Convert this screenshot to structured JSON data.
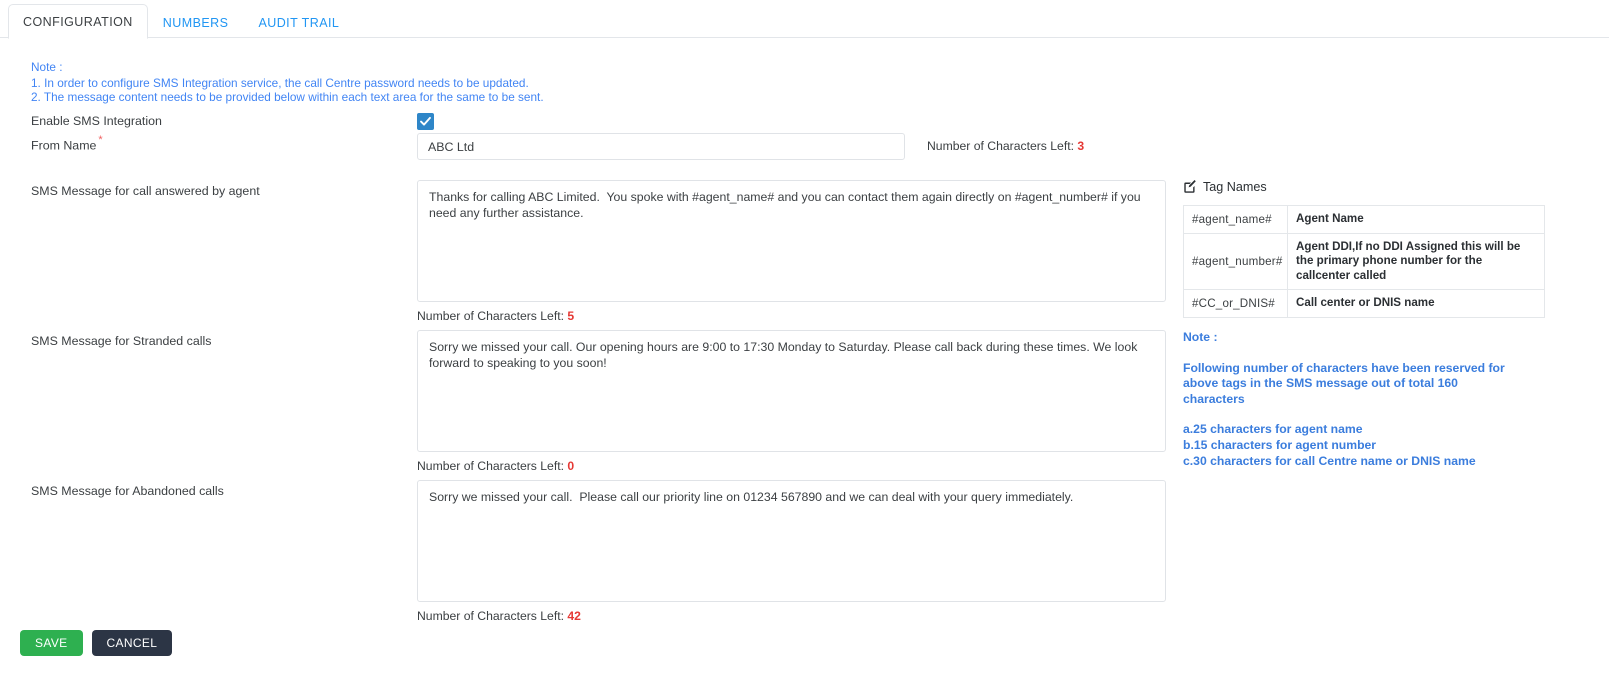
{
  "tabs": [
    {
      "label": "CONFIGURATION",
      "active": true
    },
    {
      "label": "NUMBERS",
      "active": false
    },
    {
      "label": "AUDIT TRAIL",
      "active": false
    }
  ],
  "top_note": {
    "heading": "Note :",
    "line1": "1. In order to configure SMS Integration service, the call Centre password needs to be updated.",
    "line2": "2. The message content needs to be provided below within each text area for the same to be sent."
  },
  "form": {
    "enable_label": "Enable SMS Integration",
    "enable_checked": true,
    "checkbox_color": "#2e86c8",
    "from_label": "From Name",
    "from_required_marker": "*",
    "from_value": "ABC Ltd",
    "from_placeholder": "",
    "from_count_label": "Number of Characters Left:",
    "from_count_value": "3"
  },
  "messages": [
    {
      "label": "SMS Message for call answered by agent",
      "value": "Thanks for calling ABC Limited.  You spoke with #agent_name# and you can contact them again directly on #agent_number# if you need any further assistance.",
      "placeholder": "",
      "count_label": "Number of Characters Left:",
      "count_value": "5"
    },
    {
      "label": "SMS Message for Stranded calls",
      "value": "Sorry we missed your call. Our opening hours are 9:00 to 17:30 Monday to Saturday. Please call back during these times. We look forward to speaking to you soon!",
      "placeholder": "",
      "count_label": "Number of Characters Left:",
      "count_value": "0"
    },
    {
      "label": "SMS Message for Abandoned calls",
      "value": "Sorry we missed your call.  Please call our priority line on 01234 567890 and we can deal with your query immediately.",
      "placeholder": "",
      "count_label": "Number of Characters Left:",
      "count_value": "42"
    }
  ],
  "tag_panel": {
    "icon": "pencil-square-icon",
    "title": "Tag Names",
    "rows": [
      {
        "tag": "#agent_name#",
        "description": "Agent Name"
      },
      {
        "tag": "#agent_number#",
        "description": "Agent DDI,If no DDI Assigned this will be the primary phone number for the callcenter called"
      },
      {
        "tag": "#CC_or_DNIS#",
        "description": "Call center or DNIS name"
      }
    ]
  },
  "right_note": {
    "heading": "Note :",
    "body": "Following number of characters have been reserved for above tags in the SMS message out of total 160 characters",
    "items": [
      "a.25 characters for agent name",
      "b.15 characters for agent number",
      "c.30 characters for call Centre name or DNIS name"
    ],
    "color": "#3b7ddd"
  },
  "buttons": {
    "save": "SAVE",
    "cancel": "CANCEL",
    "save_color": "#2eb050",
    "cancel_color": "#2c3545"
  }
}
